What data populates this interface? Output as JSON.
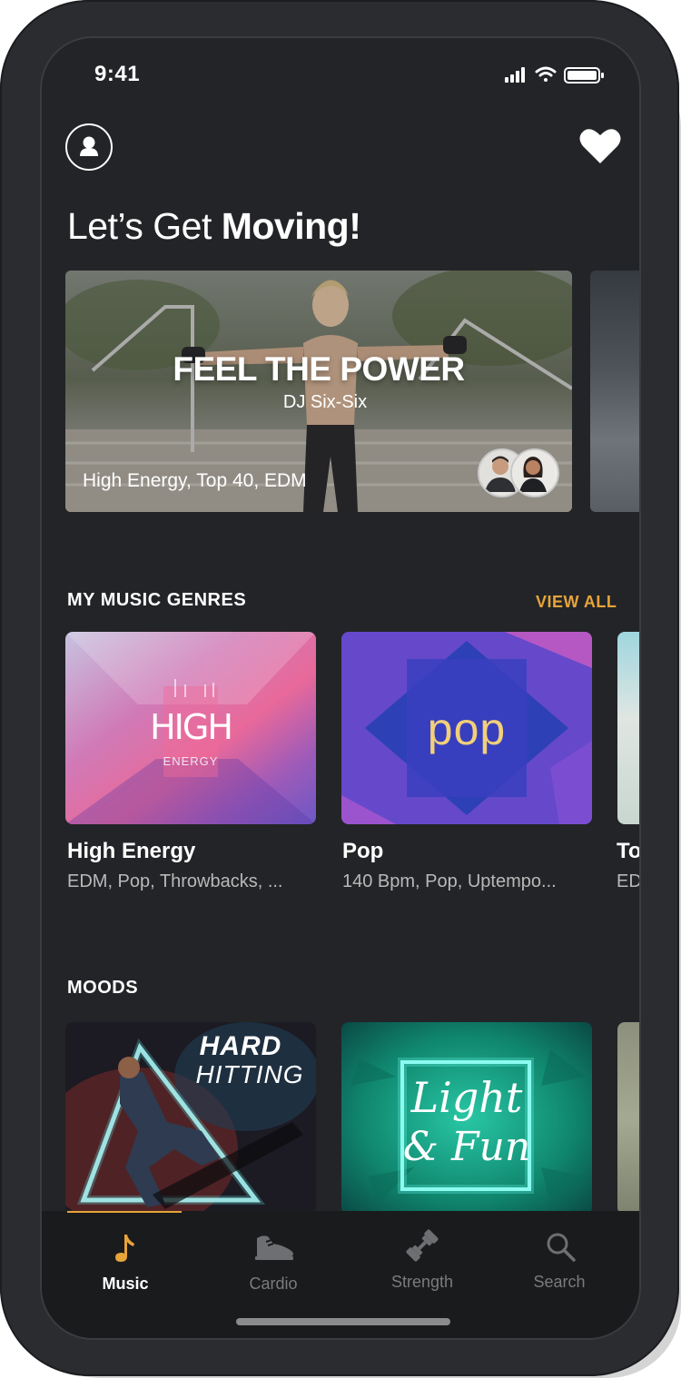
{
  "status_bar": {
    "time": "9:41"
  },
  "header": {
    "headline_light": "Let’s Get ",
    "headline_bold": "Moving!"
  },
  "hero": {
    "title": "FEEL THE POWER",
    "dj": "DJ Six-Six",
    "tags": "High Energy, Top 40, EDM"
  },
  "genres": {
    "section_title": "MY MUSIC GENRES",
    "view_all": "VIEW ALL",
    "items": [
      {
        "name": "High Energy",
        "desc": "EDM, Pop, Throwbacks, ...",
        "art_line1": "HIGH",
        "art_line2": "ENERGY"
      },
      {
        "name": "Pop",
        "desc": "140 Bpm, Pop, Uptempo...",
        "art": "pop"
      },
      {
        "name": "To",
        "desc": "ED"
      }
    ]
  },
  "moods": {
    "section_title": "MOODS",
    "items": [
      {
        "art_line1": "HARD",
        "art_line2": "HITTING"
      },
      {
        "art_line1": "Light",
        "art_line2": "& Fun"
      }
    ]
  },
  "tabs": [
    {
      "label": "Music",
      "icon": "music-note-icon",
      "active": true
    },
    {
      "label": "Cardio",
      "icon": "sneaker-icon",
      "active": false
    },
    {
      "label": "Strength",
      "icon": "dumbbell-icon",
      "active": false
    },
    {
      "label": "Search",
      "icon": "search-icon",
      "active": false
    }
  ],
  "colors": {
    "accent": "#e6a43a",
    "background": "#232427",
    "tabbar": "#1a1b1d"
  }
}
